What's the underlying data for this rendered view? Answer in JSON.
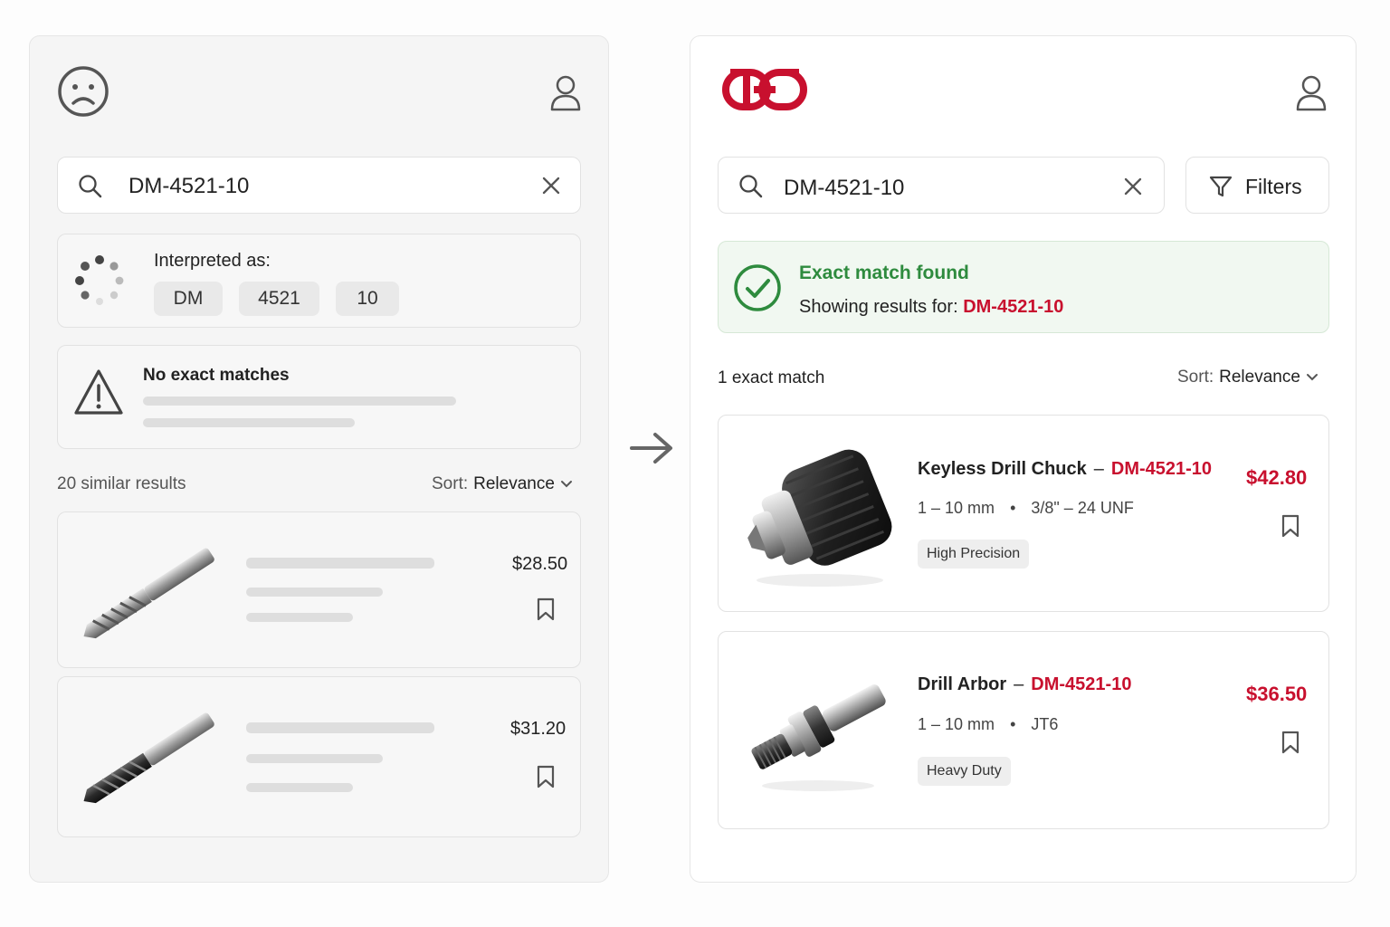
{
  "left": {
    "search": {
      "value": "DM-4521-10"
    },
    "interpreted": {
      "label": "Interpreted as:",
      "tokens": [
        "DM",
        "4521",
        "10"
      ]
    },
    "warning": {
      "title": "No exact matches"
    },
    "results_count": "20 similar results",
    "sort": {
      "label": "Sort:",
      "value": "Relevance"
    },
    "items": [
      {
        "price": "$28.50"
      },
      {
        "price": "$31.20"
      }
    ]
  },
  "right": {
    "search": {
      "value": "DM-4521-10"
    },
    "filters_label": "Filters",
    "banner": {
      "title": "Exact match found",
      "subtitle_prefix": "Showing results for:",
      "query": "DM-4521-10"
    },
    "results_count": "1 exact match",
    "sort": {
      "label": "Sort:",
      "value": "Relevance"
    },
    "items": [
      {
        "name": "Keyless Drill Chuck",
        "sep": "–",
        "sku": "DM-4521-10",
        "range": "1 – 10 mm",
        "bullet": "•",
        "spec": "3/8\" – 24 UNF",
        "tag": "High Precision",
        "price": "$42.80"
      },
      {
        "name": "Drill Arbor",
        "sep": "–",
        "sku": "DM-4521-10",
        "range": "1 – 10 mm",
        "bullet": "•",
        "spec": "JT6",
        "tag": "Heavy Duty",
        "price": "$36.50"
      }
    ]
  },
  "colors": {
    "brand": "#c8102e",
    "success": "#2e8b3e",
    "success_bg": "#f1f8f1"
  }
}
